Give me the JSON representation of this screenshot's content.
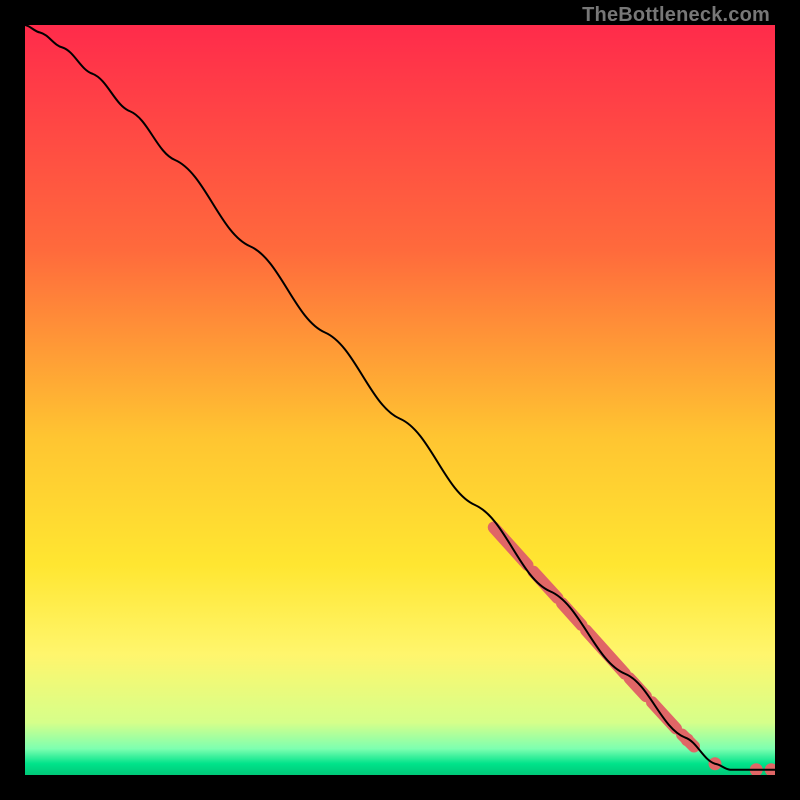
{
  "watermark": "TheBottleneck.com",
  "chart_data": {
    "type": "line",
    "title": "",
    "xlabel": "",
    "ylabel": "",
    "xlim": [
      0,
      100
    ],
    "ylim": [
      0,
      100
    ],
    "background_gradient": {
      "stops": [
        {
          "offset": 0.0,
          "color": "#ff2b4b"
        },
        {
          "offset": 0.3,
          "color": "#ff6a3c"
        },
        {
          "offset": 0.55,
          "color": "#ffc531"
        },
        {
          "offset": 0.72,
          "color": "#ffe631"
        },
        {
          "offset": 0.84,
          "color": "#fff66d"
        },
        {
          "offset": 0.93,
          "color": "#d6ff8a"
        },
        {
          "offset": 0.965,
          "color": "#7dffb0"
        },
        {
          "offset": 0.985,
          "color": "#00e38a"
        },
        {
          "offset": 1.0,
          "color": "#00c878"
        }
      ]
    },
    "curve": [
      {
        "x": 0.0,
        "y": 100.0
      },
      {
        "x": 2.0,
        "y": 99.0
      },
      {
        "x": 5.0,
        "y": 97.0
      },
      {
        "x": 9.0,
        "y": 93.5
      },
      {
        "x": 14.0,
        "y": 88.5
      },
      {
        "x": 20.0,
        "y": 82.0
      },
      {
        "x": 30.0,
        "y": 70.5
      },
      {
        "x": 40.0,
        "y": 59.0
      },
      {
        "x": 50.0,
        "y": 47.5
      },
      {
        "x": 60.0,
        "y": 36.0
      },
      {
        "x": 70.0,
        "y": 24.5
      },
      {
        "x": 80.0,
        "y": 13.5
      },
      {
        "x": 88.0,
        "y": 5.0
      },
      {
        "x": 92.0,
        "y": 1.5
      },
      {
        "x": 94.0,
        "y": 0.7
      },
      {
        "x": 97.0,
        "y": 0.7
      },
      {
        "x": 100.0,
        "y": 0.7
      }
    ],
    "marker_segments": [
      {
        "x1": 62.5,
        "y1": 33.0,
        "x2": 67.0,
        "y2": 28.0
      },
      {
        "x1": 67.8,
        "y1": 27.1,
        "x2": 71.0,
        "y2": 23.6
      },
      {
        "x1": 71.6,
        "y1": 22.9,
        "x2": 74.2,
        "y2": 20.0
      },
      {
        "x1": 74.8,
        "y1": 19.3,
        "x2": 80.0,
        "y2": 13.5
      },
      {
        "x1": 80.6,
        "y1": 12.9,
        "x2": 82.8,
        "y2": 10.5
      },
      {
        "x1": 83.6,
        "y1": 9.7,
        "x2": 86.8,
        "y2": 6.2
      },
      {
        "x1": 87.6,
        "y1": 5.4,
        "x2": 89.2,
        "y2": 3.8
      }
    ],
    "marker_points": [
      {
        "x": 88.3,
        "y": 4.7
      },
      {
        "x": 92.0,
        "y": 1.5
      },
      {
        "x": 97.5,
        "y": 0.7
      },
      {
        "x": 99.5,
        "y": 0.7
      }
    ],
    "marker_color": "#e06666",
    "curve_color": "#000000"
  }
}
